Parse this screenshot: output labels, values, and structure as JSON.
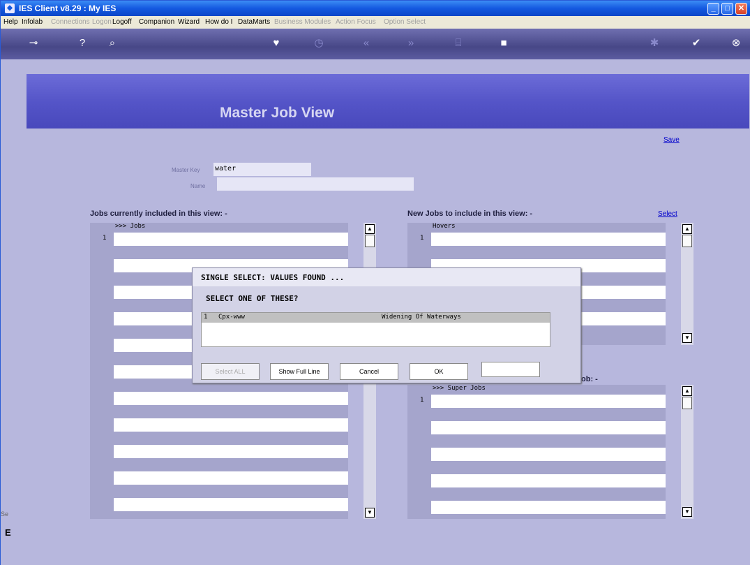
{
  "window": {
    "title": "IES Client v8.29 : My IES"
  },
  "menu": [
    {
      "label": "Help",
      "enabled": true
    },
    {
      "label": "Infolab",
      "enabled": true
    },
    {
      "label": "Connections",
      "enabled": false
    },
    {
      "label": "Logon",
      "enabled": false
    },
    {
      "label": "Logoff",
      "enabled": true
    },
    {
      "label": "Companion",
      "enabled": true
    },
    {
      "label": "Wizard",
      "enabled": true
    },
    {
      "label": "How do I",
      "enabled": true
    },
    {
      "label": "DataMarts",
      "enabled": true
    },
    {
      "label": "Business Modules",
      "enabled": false
    },
    {
      "label": "Action Focus",
      "enabled": false
    },
    {
      "label": "Option Select",
      "enabled": false
    }
  ],
  "page": {
    "title": "Master Job View",
    "save_label": "Save"
  },
  "form": {
    "master_key_label": "Master Key",
    "master_key_value": "water",
    "name_label": "Name",
    "name_value": ""
  },
  "left_panel": {
    "title": "Jobs currently included in this view: -",
    "column": ">>> Jobs",
    "row_num": "1"
  },
  "right_panel": {
    "title": "New Jobs to include in this view: -",
    "select_label": "Select",
    "column": "Hovers",
    "row_num": "1"
  },
  "super_panel": {
    "title_tail": "ob: -",
    "column": ">>> Super Jobs",
    "row_num": "1"
  },
  "dialog": {
    "title": "SINGLE SELECT: VALUES FOUND ...",
    "prompt": "SELECT ONE OF THESE?",
    "rows": [
      {
        "num": "1",
        "code": "Cpx-www",
        "desc": "Widening Of Waterways"
      }
    ],
    "buttons": {
      "select_all": "Select ALL",
      "show_full_line": "Show Full Line",
      "cancel": "Cancel",
      "ok": "OK"
    }
  },
  "sidebar": {
    "stub_text": "Se",
    "stub_glyph": "E"
  }
}
